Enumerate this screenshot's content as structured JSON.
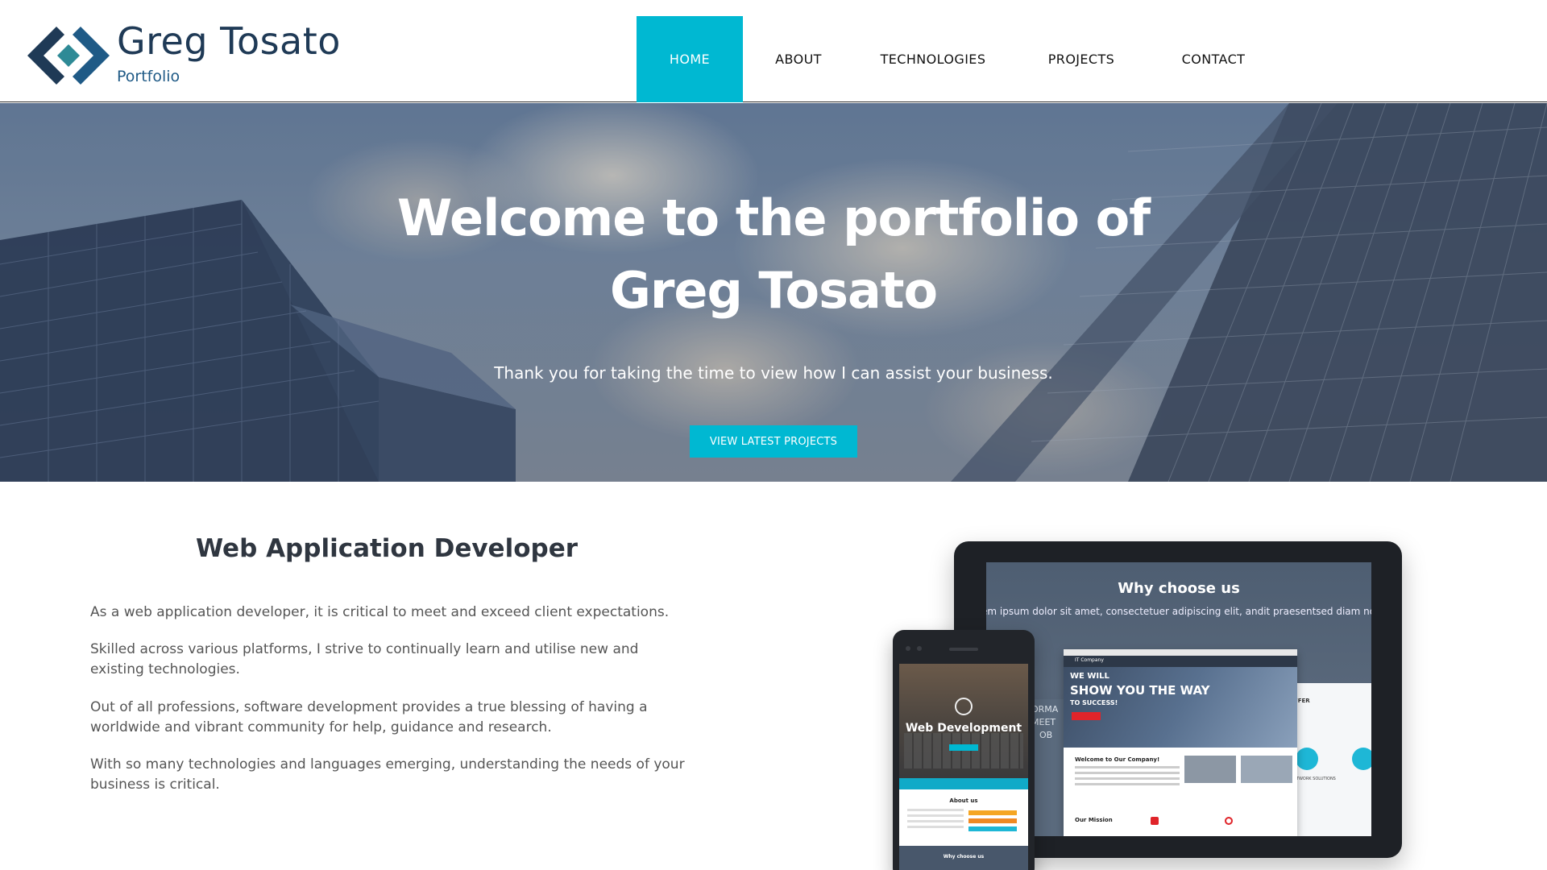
{
  "header": {
    "brand_name": "Greg Tosato",
    "brand_sub": "Portfolio",
    "logo_colors": {
      "dark": "#1f3a56",
      "teal": "#2e8a96"
    }
  },
  "nav": {
    "items": [
      {
        "label": "HOME",
        "active": true
      },
      {
        "label": "ABOUT",
        "active": false
      },
      {
        "label": "TECHNOLOGIES",
        "active": false
      },
      {
        "label": "PROJECTS",
        "active": false
      },
      {
        "label": "CONTACT",
        "active": false
      }
    ],
    "active_color": "#00b8d2"
  },
  "hero": {
    "title_line1": "Welcome to the portfolio of",
    "title_line2": "Greg Tosato",
    "subtitle": "Thank you for taking the time to view how I can assist your business.",
    "button_label": "VIEW LATEST PROJECTS"
  },
  "about": {
    "title": "Web Application Developer",
    "paragraphs": [
      "As a web application developer, it is critical to meet and exceed client expectations.",
      "Skilled across various platforms, I strive to continually learn and utilise new and existing technologies.",
      "Out of all professions, software development provides a true blessing of having a worldwide and vibrant community for help, guidance and research.",
      "With so many technologies and languages emerging, understanding the needs of your business is critical."
    ]
  },
  "mockup": {
    "tablet_title": "Why choose us",
    "tablet_lorem": "em ipsum dolor sit amet, consectetuer adipiscing elit, andit praesentsed diam nonummy",
    "tablet_left_text": [
      "ORMA",
      "MEET",
      "OB"
    ],
    "tablet_offer": "OFFER",
    "tablet_network": "NETWORK SOLUTIONS",
    "window_logo": "IT Company",
    "window_h1": "WE WILL",
    "window_h2": "SHOW YOU THE WAY",
    "window_h3": "TO SUCCESS!",
    "window_welcome": "Welcome to Our Company!",
    "window_mission": "Our Mission",
    "phone_title": "Web Development",
    "phone_about": "About us",
    "phone_why": "Why choose us"
  }
}
